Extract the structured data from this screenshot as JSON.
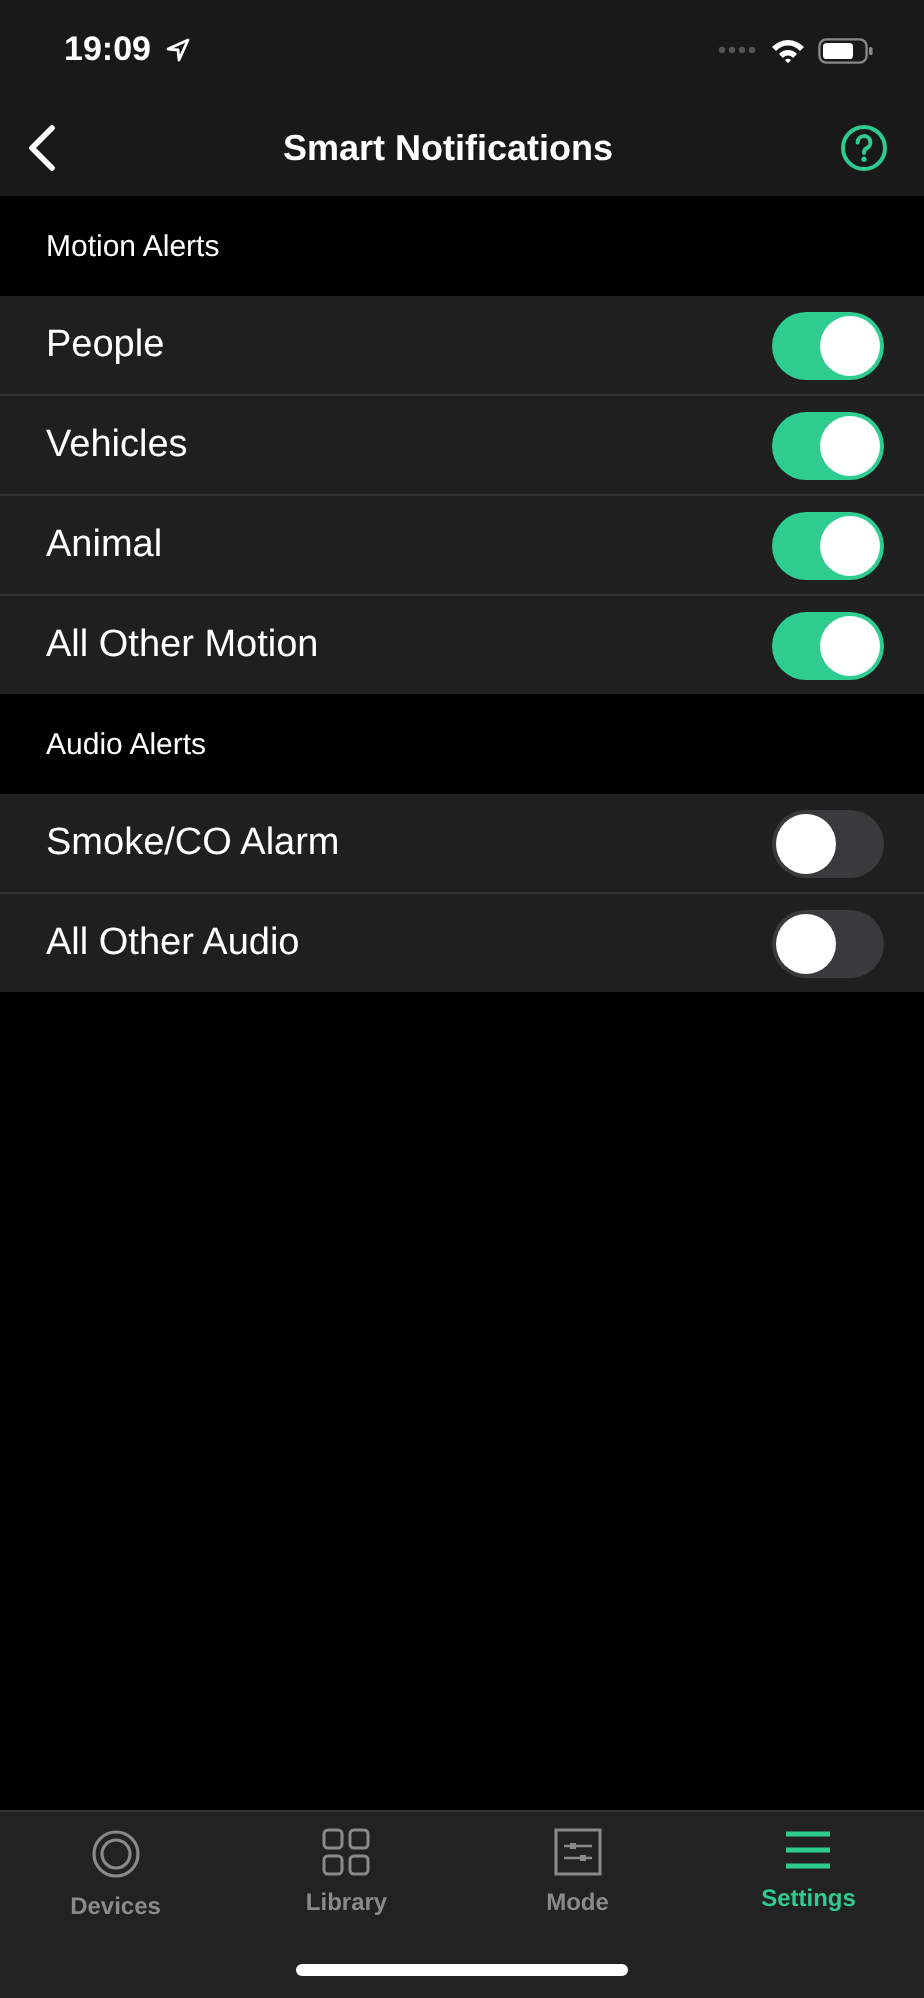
{
  "status_bar": {
    "time": "19:09"
  },
  "nav": {
    "title": "Smart Notifications"
  },
  "sections": [
    {
      "title": "Motion Alerts",
      "items": [
        {
          "label": "People",
          "on": true
        },
        {
          "label": "Vehicles",
          "on": true
        },
        {
          "label": "Animal",
          "on": true
        },
        {
          "label": "All Other Motion",
          "on": true
        }
      ]
    },
    {
      "title": "Audio Alerts",
      "items": [
        {
          "label": "Smoke/CO Alarm",
          "on": false
        },
        {
          "label": "All Other Audio",
          "on": false
        }
      ]
    }
  ],
  "tabs": [
    {
      "label": "Devices",
      "kind": "devices",
      "selected": false
    },
    {
      "label": "Library",
      "kind": "library",
      "selected": false
    },
    {
      "label": "Mode",
      "kind": "mode",
      "selected": false
    },
    {
      "label": "Settings",
      "kind": "settings",
      "selected": true
    }
  ]
}
